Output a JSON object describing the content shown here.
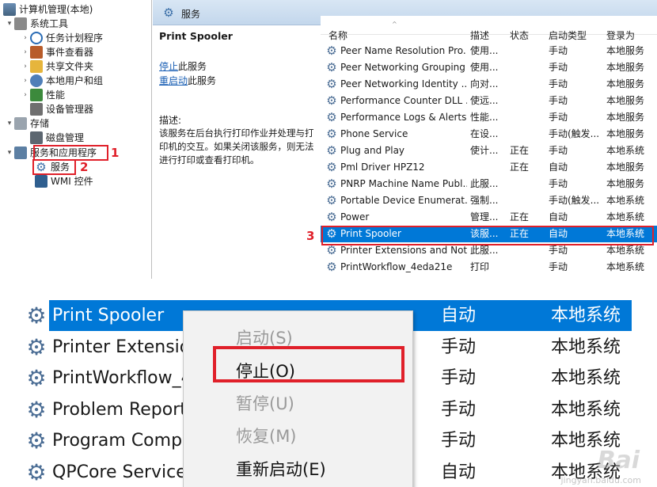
{
  "tree": {
    "root": "计算机管理(本地)",
    "system_tools": "系统工具",
    "task_scheduler": "任务计划程序",
    "event_viewer": "事件查看器",
    "shared_folders": "共享文件夹",
    "local_users": "本地用户和组",
    "performance": "性能",
    "device_manager": "设备管理器",
    "storage": "存储",
    "disk_management": "磁盘管理",
    "services_apps": "服务和应用程序",
    "services": "服务",
    "wmi": "WMI 控件"
  },
  "annotations": {
    "n1": "1",
    "n2": "2",
    "n3": "3"
  },
  "header": {
    "title": "服务"
  },
  "detail": {
    "name": "Print Spooler",
    "stop_link": "停止",
    "stop_suffix": "此服务",
    "restart_link": "重启动",
    "restart_suffix": "此服务",
    "desc_label": "描述:",
    "desc": "该服务在后台执行打印作业并处理与打印机的交互。如果关闭该服务，则无法进行打印或查看打印机。"
  },
  "columns": {
    "name": "名称",
    "desc": "描述",
    "state": "状态",
    "startup": "启动类型",
    "logon": "登录为"
  },
  "services": [
    {
      "name": "Peer Name Resolution Pro...",
      "desc": "使用...",
      "state": "",
      "startup": "手动",
      "logon": "本地服务"
    },
    {
      "name": "Peer Networking Grouping",
      "desc": "使用...",
      "state": "",
      "startup": "手动",
      "logon": "本地服务"
    },
    {
      "name": "Peer Networking Identity ...",
      "desc": "向对...",
      "state": "",
      "startup": "手动",
      "logon": "本地服务"
    },
    {
      "name": "Performance Counter DLL ...",
      "desc": "使远...",
      "state": "",
      "startup": "手动",
      "logon": "本地服务"
    },
    {
      "name": "Performance Logs & Alerts",
      "desc": "性能...",
      "state": "",
      "startup": "手动",
      "logon": "本地服务"
    },
    {
      "name": "Phone Service",
      "desc": "在设...",
      "state": "",
      "startup": "手动(触发...",
      "logon": "本地服务"
    },
    {
      "name": "Plug and Play",
      "desc": "使计...",
      "state": "正在",
      "startup": "手动",
      "logon": "本地系统"
    },
    {
      "name": "Pml Driver HPZ12",
      "desc": "",
      "state": "正在",
      "startup": "自动",
      "logon": "本地服务"
    },
    {
      "name": "PNRP Machine Name Publ...",
      "desc": "此服...",
      "state": "",
      "startup": "手动",
      "logon": "本地服务"
    },
    {
      "name": "Portable Device Enumerat...",
      "desc": "强制...",
      "state": "",
      "startup": "手动(触发...",
      "logon": "本地系统"
    },
    {
      "name": "Power",
      "desc": "管理...",
      "state": "正在",
      "startup": "自动",
      "logon": "本地系统"
    },
    {
      "name": "Print Spooler",
      "desc": "该服...",
      "state": "正在",
      "startup": "自动",
      "logon": "本地系统"
    },
    {
      "name": "Printer Extensions and Noti...",
      "desc": "此服...",
      "state": "",
      "startup": "手动",
      "logon": "本地系统"
    },
    {
      "name": "PrintWorkflow_4eda21e",
      "desc": "打印",
      "state": "",
      "startup": "手动",
      "logon": "本地系统"
    }
  ],
  "zoom": {
    "rows": [
      {
        "name": "Print Spooler",
        "startup": "自动",
        "logon": "本地系统"
      },
      {
        "name": "Printer Extension",
        "startup": "手动",
        "logon": "本地系统"
      },
      {
        "name": "PrintWorkflow_4",
        "startup": "手动",
        "logon": "本地系统"
      },
      {
        "name": "Problem Reports",
        "startup": "手动",
        "logon": "本地系统"
      },
      {
        "name": "Program Compa",
        "startup": "手动",
        "logon": "本地系统"
      },
      {
        "name": "QPCore Service",
        "startup": "自动",
        "logon": "本地系统"
      }
    ],
    "menu": {
      "start": "启动(S)",
      "stop": "停止(O)",
      "pause": "暂停(U)",
      "resume": "恢复(M)",
      "restart": "重新启动(E)"
    }
  },
  "watermark": {
    "main": "Bai",
    "sub": "jingyan.baidu.com"
  },
  "colors": {
    "selection": "#0078d7",
    "annotation": "#e0202a",
    "link": "#1a5fb4"
  }
}
